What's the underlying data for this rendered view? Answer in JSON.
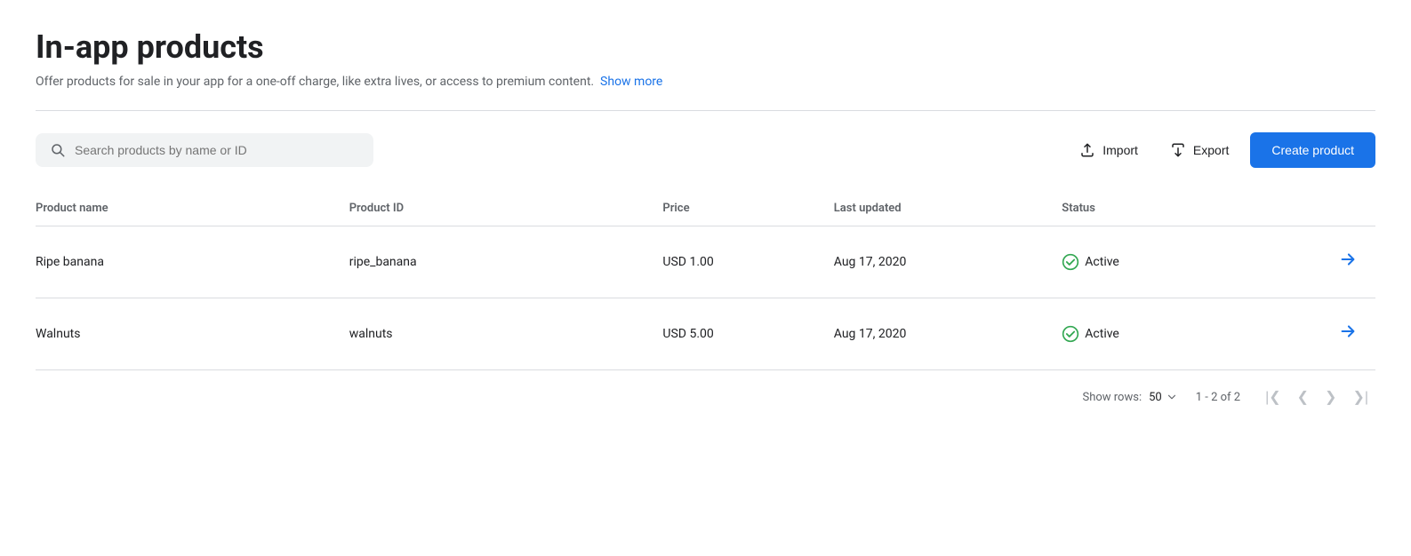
{
  "header": {
    "title": "In-app products",
    "subtitle": "Offer products for sale in your app for a one-off charge, like extra lives, or access to premium content.",
    "show_more_label": "Show more"
  },
  "toolbar": {
    "search_placeholder": "Search products by name or ID",
    "import_label": "Import",
    "export_label": "Export",
    "create_label": "Create product"
  },
  "table": {
    "columns": [
      {
        "key": "product_name",
        "label": "Product name"
      },
      {
        "key": "product_id",
        "label": "Product ID"
      },
      {
        "key": "price",
        "label": "Price"
      },
      {
        "key": "last_updated",
        "label": "Last updated"
      },
      {
        "key": "status",
        "label": "Status"
      }
    ],
    "rows": [
      {
        "product_name": "Ripe banana",
        "product_id": "ripe_banana",
        "price": "USD 1.00",
        "last_updated": "Aug 17, 2020",
        "status": "Active"
      },
      {
        "product_name": "Walnuts",
        "product_id": "walnuts",
        "price": "USD 5.00",
        "last_updated": "Aug 17, 2020",
        "status": "Active"
      }
    ]
  },
  "footer": {
    "show_rows_label": "Show rows:",
    "rows_value": "50",
    "pagination_info": "1 - 2 of 2"
  },
  "colors": {
    "active_status": "#34a853",
    "accent_blue": "#1a73e8"
  }
}
